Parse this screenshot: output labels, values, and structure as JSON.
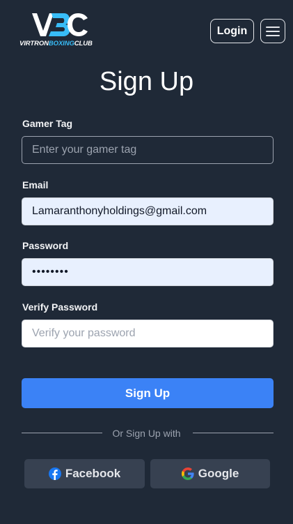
{
  "header": {
    "logo_letters": "VBC",
    "logo_text_part1": "VIRTRON",
    "logo_text_part2": "BOXING",
    "logo_text_part3": "CLUB",
    "login_label": "Login",
    "menu_icon": "hamburger-menu-icon"
  },
  "form": {
    "title": "Sign Up",
    "gamer_tag": {
      "label": "Gamer Tag",
      "placeholder": "Enter your gamer tag",
      "value": ""
    },
    "email": {
      "label": "Email",
      "value": "Lamaranthonyholdings@gmail.com"
    },
    "password": {
      "label": "Password",
      "value": "••••••••"
    },
    "verify_password": {
      "label": "Verify Password",
      "placeholder": "Verify your password",
      "value": ""
    },
    "submit_label": "Sign Up",
    "divider_text": "Or Sign Up with"
  },
  "social": {
    "facebook_label": "Facebook",
    "google_label": "Google"
  },
  "colors": {
    "background": "#1f2937",
    "accent": "#3b82f6",
    "logo_blue": "#38bdf8",
    "facebook": "#1877f2"
  }
}
